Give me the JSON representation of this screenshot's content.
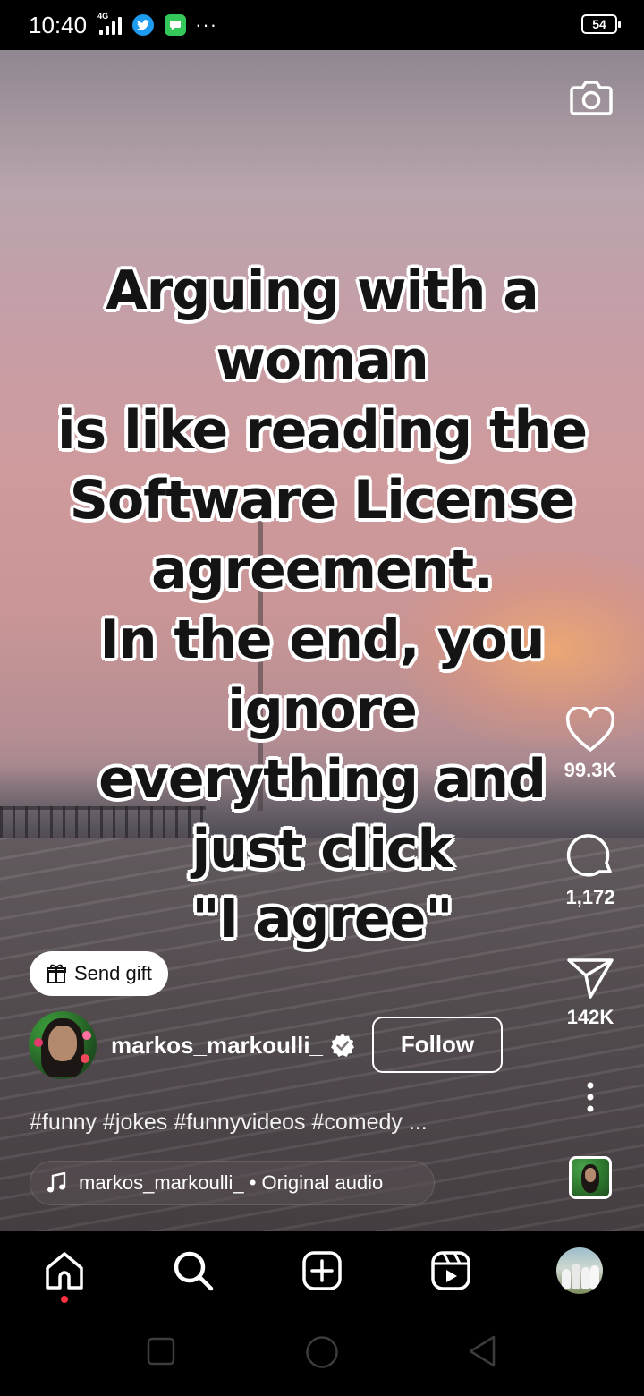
{
  "status_bar": {
    "time": "10:40",
    "network": "4G",
    "battery": "54",
    "more": "···"
  },
  "reel": {
    "caption_lines": [
      "Arguing with a woman",
      "is like reading the",
      "Software License",
      "agreement.",
      "In the end, you ignore",
      "everything and",
      "just click",
      "\"I agree\""
    ],
    "likes": "99.3K",
    "comments": "1,172",
    "shares": "142K",
    "send_gift_label": "Send gift",
    "author": "markos_markoulli_",
    "follow_label": "Follow",
    "hashtags": "#funny #jokes #funnyvideos #comedy ...",
    "audio": "markos_markoulli_ • Original audio"
  },
  "icons": {
    "camera": "camera-icon",
    "like": "heart-icon",
    "comment": "comment-icon",
    "share": "send-icon",
    "more": "more-vertical-icon",
    "gift": "gift-icon",
    "verified": "verified-badge-icon",
    "music": "music-note-icon",
    "nav": [
      "home-icon",
      "search-icon",
      "create-icon",
      "reels-icon",
      "profile-avatar"
    ]
  },
  "colors": {
    "accent_blue": "#1d9bf0",
    "notification_dot": "#ff3040",
    "background": "#000000"
  }
}
